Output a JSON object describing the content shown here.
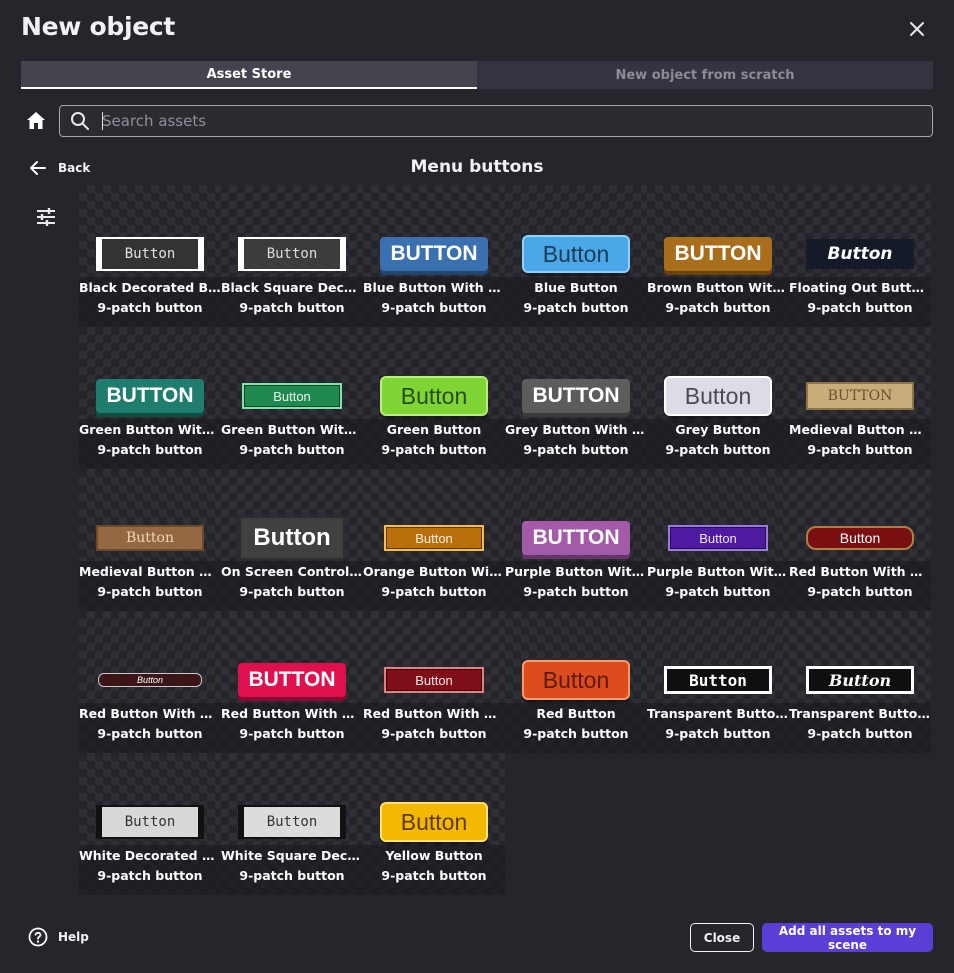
{
  "dialog": {
    "title": "New object"
  },
  "tabs": [
    {
      "label": "Asset Store",
      "active": true
    },
    {
      "label": "New object from scratch",
      "active": false
    }
  ],
  "search": {
    "placeholder": "Search assets",
    "value": ""
  },
  "nav": {
    "back_label": "Back",
    "section_title": "Menu buttons"
  },
  "assets": [
    {
      "name": "Black Decorated Button",
      "display_name": "Black Decorated But…",
      "tag": "9-patch button",
      "preview": {
        "text": "Button",
        "style": "decorated",
        "bg": "#333333",
        "fg": "#e0e0e0",
        "border": "#ffffff",
        "w": 108,
        "h": 34
      }
    },
    {
      "name": "Black Square Decorated Button",
      "display_name": "Black Square Decor…",
      "tag": "9-patch button",
      "preview": {
        "text": "Button",
        "style": "decorated",
        "bg": "#3c3c3c",
        "fg": "#dddddd",
        "border": "#ffffff",
        "w": 108,
        "h": 34
      }
    },
    {
      "name": "Blue Button With Shadow",
      "display_name": "Blue Button With Sh…",
      "tag": "9-patch button",
      "preview": {
        "text": "BUTTON",
        "style": "shadow",
        "bg": "#3a6fb0",
        "fg": "#ffffff",
        "shadow": "#23446e",
        "w": 108,
        "h": 34
      }
    },
    {
      "name": "Blue Button",
      "display_name": "Blue Button",
      "tag": "9-patch button",
      "preview": {
        "text": "Button",
        "style": "glossy",
        "bg": "#4aa8e8",
        "fg": "#1d3b55",
        "border": "#8fd0ff",
        "w": 108,
        "h": 38
      }
    },
    {
      "name": "Brown Button With Shadow",
      "display_name": "Brown Button With …",
      "tag": "9-patch button",
      "preview": {
        "text": "BUTTON",
        "style": "shadow",
        "bg": "#a86e1c",
        "fg": "#ffffff",
        "shadow": "#6b4310",
        "w": 108,
        "h": 34
      }
    },
    {
      "name": "Floating Out Button",
      "display_name": "Floating Out Button …",
      "tag": "9-patch button",
      "preview": {
        "text": "Button",
        "style": "dark-italic",
        "bg": "#151a28",
        "fg": "#ffffff",
        "w": 108,
        "h": 30
      }
    },
    {
      "name": "Green Button With Shadow",
      "display_name": "Green Button With S…",
      "tag": "9-patch button",
      "preview": {
        "text": "BUTTON",
        "style": "shadow",
        "bg": "#1f7d6e",
        "fg": "#ffffff",
        "shadow": "#114c43",
        "w": 108,
        "h": 34
      }
    },
    {
      "name": "Green Button With Stone Border",
      "display_name": "Green Button With S…",
      "tag": "9-patch button",
      "preview": {
        "text": "Button",
        "style": "fancy",
        "bg": "#1f8a50",
        "fg": "#e9f7ee",
        "border": "#7fe0a8",
        "w": 100,
        "h": 26
      }
    },
    {
      "name": "Green Button",
      "display_name": "Green Button",
      "tag": "9-patch button",
      "preview": {
        "text": "Button",
        "style": "glossy",
        "bg": "#7ed534",
        "fg": "#2a4a12",
        "border": "#b7ef7e",
        "w": 108,
        "h": 40
      }
    },
    {
      "name": "Grey Button With Shadow",
      "display_name": "Grey Button With Sh…",
      "tag": "9-patch button",
      "preview": {
        "text": "BUTTON",
        "style": "shadow",
        "bg": "#5c5c5c",
        "fg": "#ffffff",
        "shadow": "#3a3a3a",
        "w": 108,
        "h": 34
      }
    },
    {
      "name": "Grey Button",
      "display_name": "Grey Button",
      "tag": "9-patch button",
      "preview": {
        "text": "Button",
        "style": "glossy",
        "bg": "#dcdce6",
        "fg": "#4a4a55",
        "border": "#ffffff",
        "w": 108,
        "h": 40
      }
    },
    {
      "name": "Medieval Button Beige",
      "display_name": "Medieval Button Bei…",
      "tag": "9-patch button",
      "preview": {
        "text": "BUTTON",
        "style": "medieval",
        "bg": "#c8ad7a",
        "fg": "#6b5030",
        "border": "#8f7448",
        "w": 108,
        "h": 28
      }
    },
    {
      "name": "Medieval Button Brown",
      "display_name": "Medieval Button Bro…",
      "tag": "9-patch button",
      "preview": {
        "text": "Button",
        "style": "medieval",
        "bg": "#946842",
        "fg": "#f0d7b0",
        "border": "#6b4a2c",
        "w": 108,
        "h": 26
      }
    },
    {
      "name": "On Screen Controls Button",
      "display_name": "On Screen Controls …",
      "tag": "9-patch button",
      "preview": {
        "text": "Button",
        "style": "plain",
        "bg": "#404040",
        "fg": "#ffffff",
        "border": "#2c2c2c",
        "w": 108,
        "h": 46
      }
    },
    {
      "name": "Orange Button With Stone Border",
      "display_name": "Orange Button With …",
      "tag": "9-patch button",
      "preview": {
        "text": "Button",
        "style": "fancy",
        "bg": "#b86f0c",
        "fg": "#fff0d8",
        "border": "#f2c04a",
        "w": 100,
        "h": 26
      }
    },
    {
      "name": "Purple Button With Shadow",
      "display_name": "Purple Button With …",
      "tag": "9-patch button",
      "preview": {
        "text": "BUTTON",
        "style": "shadow",
        "bg": "#a35aa8",
        "fg": "#ffffff",
        "shadow": "#66366a",
        "w": 108,
        "h": 34
      }
    },
    {
      "name": "Purple Button With Stone Border",
      "display_name": "Purple Button With …",
      "tag": "9-patch button",
      "preview": {
        "text": "Button",
        "style": "fancy",
        "bg": "#4d1aa0",
        "fg": "#efe6ff",
        "border": "#9a7ae0",
        "w": 100,
        "h": 26
      }
    },
    {
      "name": "Red Button With Gold Border",
      "display_name": "Red Button With Gol…",
      "tag": "9-patch button",
      "preview": {
        "text": "Button",
        "style": "hex",
        "bg": "#7a0f12",
        "fg": "#ffffff",
        "border": "#b08040",
        "w": 108,
        "h": 24
      }
    },
    {
      "name": "Red Button With Metal",
      "display_name": "Red Button With Me…",
      "tag": "9-patch button",
      "preview": {
        "text": "Button",
        "style": "ribbon",
        "bg": "#3a1416",
        "fg": "#ffffff",
        "border": "#c9c9c9",
        "w": 104,
        "h": 14
      }
    },
    {
      "name": "Red Button With Shadow",
      "display_name": "Red Button With Sh…",
      "tag": "9-patch button",
      "preview": {
        "text": "BUTTON",
        "style": "shadow",
        "bg": "#e0104e",
        "fg": "#ffffff",
        "shadow": "#8c0a31",
        "w": 108,
        "h": 34
      }
    },
    {
      "name": "Red Button With Stone Border",
      "display_name": "Red Button With Sto…",
      "tag": "9-patch button",
      "preview": {
        "text": "Button",
        "style": "fancy",
        "bg": "#7e0f18",
        "fg": "#ffe6e6",
        "border": "#e08080",
        "w": 100,
        "h": 26
      }
    },
    {
      "name": "Red Button",
      "display_name": "Red Button",
      "tag": "9-patch button",
      "preview": {
        "text": "Button",
        "style": "glossy",
        "bg": "#dc4c1c",
        "fg": "#5a1a06",
        "border": "#ff9a6c",
        "w": 108,
        "h": 40
      }
    },
    {
      "name": "Transparent Button",
      "display_name": "Transparent Button …",
      "tag": "9-patch button",
      "preview": {
        "text": "Button",
        "style": "outline",
        "bg": "#0f0f12",
        "fg": "#ffffff",
        "border": "#ffffff",
        "w": 108,
        "h": 28
      }
    },
    {
      "name": "Transparent Button Italic",
      "display_name": "Transparent Button …",
      "tag": "9-patch button",
      "preview": {
        "text": "Button",
        "style": "outline-italic",
        "bg": "#0f0f12",
        "fg": "#ffffff",
        "border": "#ffffff",
        "w": 108,
        "h": 28
      }
    },
    {
      "name": "White Decorated Button",
      "display_name": "White Decorated Bu…",
      "tag": "9-patch button",
      "preview": {
        "text": "Button",
        "style": "decorated",
        "bg": "#d8d8d8",
        "fg": "#333333",
        "border": "#111111",
        "w": 108,
        "h": 34
      }
    },
    {
      "name": "White Square Decorated Button",
      "display_name": "White Square Decor…",
      "tag": "9-patch button",
      "preview": {
        "text": "Button",
        "style": "decorated",
        "bg": "#dcdcdc",
        "fg": "#333333",
        "border": "#111111",
        "w": 108,
        "h": 34
      }
    },
    {
      "name": "Yellow Button",
      "display_name": "Yellow Button",
      "tag": "9-patch button",
      "preview": {
        "text": "Button",
        "style": "glossy",
        "bg": "#f5b800",
        "fg": "#5a3c00",
        "border": "#ffe270",
        "w": 108,
        "h": 40
      }
    }
  ],
  "footer": {
    "help_label": "Help",
    "close_label": "Close",
    "add_all_label": "Add all assets to my scene"
  },
  "colors": {
    "background": "#25252b",
    "accent": "#5a3ed6",
    "tab_active": "#44444e",
    "tab_inactive": "#343440"
  }
}
